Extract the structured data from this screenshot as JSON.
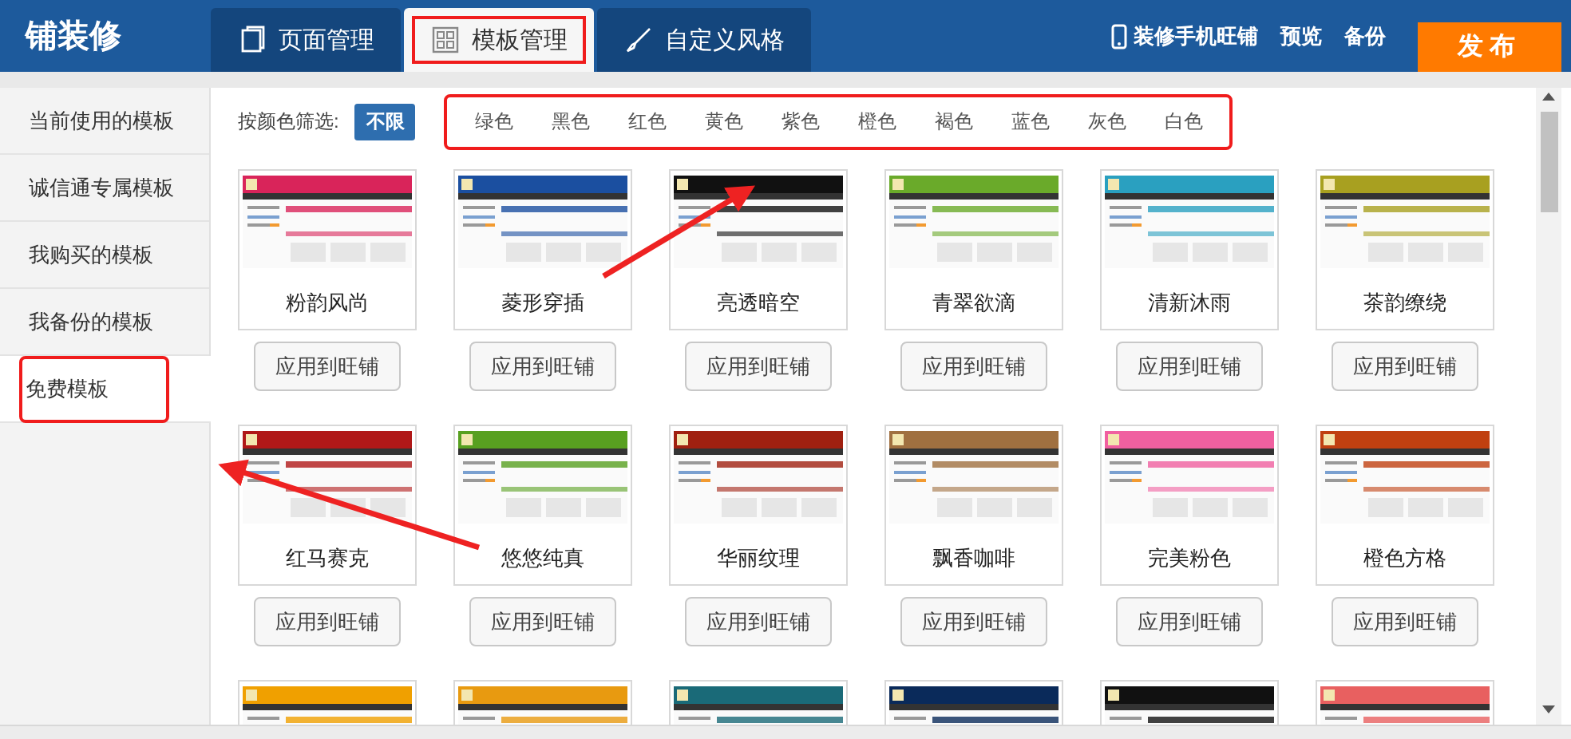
{
  "header": {
    "title": "铺装修",
    "tabs": [
      {
        "label": "页面管理",
        "selected": false,
        "highlighted": false
      },
      {
        "label": "模板管理",
        "selected": true,
        "highlighted": true
      },
      {
        "label": "自定义风格",
        "selected": false,
        "highlighted": false
      }
    ],
    "links": [
      {
        "label": "装修手机旺铺",
        "kind": "phone"
      },
      {
        "label": "预览",
        "kind": "plain"
      },
      {
        "label": "备份",
        "kind": "plain"
      }
    ],
    "publish_button": "发布"
  },
  "sidebar": {
    "items": [
      {
        "label": "当前使用的模板",
        "selected": false,
        "highlighted": false
      },
      {
        "label": "诚信通专属模板",
        "selected": false,
        "highlighted": false
      },
      {
        "label": "我购买的模板",
        "selected": false,
        "highlighted": false
      },
      {
        "label": "我备份的模板",
        "selected": false,
        "highlighted": false
      },
      {
        "label": "免费模板",
        "selected": true,
        "highlighted": true
      }
    ]
  },
  "filter": {
    "label": "按颜色筛选:",
    "highlighted": true,
    "options": [
      {
        "label": "不限",
        "selected": true
      },
      {
        "label": "绿色",
        "selected": false
      },
      {
        "label": "黑色",
        "selected": false
      },
      {
        "label": "红色",
        "selected": false
      },
      {
        "label": "黄色",
        "selected": false
      },
      {
        "label": "紫色",
        "selected": false
      },
      {
        "label": "橙色",
        "selected": false
      },
      {
        "label": "褐色",
        "selected": false
      },
      {
        "label": "蓝色",
        "selected": false
      },
      {
        "label": "灰色",
        "selected": false
      },
      {
        "label": "白色",
        "selected": false
      }
    ]
  },
  "templates": [
    {
      "name": "粉韵风尚",
      "color": "#d9245a",
      "button": "应用到旺铺"
    },
    {
      "name": "菱形穿插",
      "color": "#1b4fa0",
      "button": "应用到旺铺"
    },
    {
      "name": "亮透暗空",
      "color": "#111111",
      "button": "应用到旺铺"
    },
    {
      "name": "青翠欲滴",
      "color": "#6aaa2a",
      "button": "应用到旺铺"
    },
    {
      "name": "清新沐雨",
      "color": "#2aa0c0",
      "button": "应用到旺铺"
    },
    {
      "name": "茶韵缭绕",
      "color": "#a8a020",
      "button": "应用到旺铺"
    },
    {
      "name": "红马赛克",
      "color": "#b01818",
      "button": "应用到旺铺"
    },
    {
      "name": "悠悠纯真",
      "color": "#58a020",
      "button": "应用到旺铺"
    },
    {
      "name": "华丽纹理",
      "color": "#a02010",
      "button": "应用到旺铺"
    },
    {
      "name": "飘香咖啡",
      "color": "#a07040",
      "button": "应用到旺铺"
    },
    {
      "name": "完美粉色",
      "color": "#f060a0",
      "button": "应用到旺铺"
    },
    {
      "name": "橙色方格",
      "color": "#c04010",
      "button": "应用到旺铺"
    },
    {
      "color": "#f0a000"
    },
    {
      "color": "#e89a10"
    },
    {
      "color": "#1a6a78"
    },
    {
      "color": "#0a2a5a"
    },
    {
      "color": "#111111"
    },
    {
      "color": "#e86060"
    }
  ],
  "annotation_arrows": [
    {
      "kind": "arrow"
    },
    {
      "kind": "arrow"
    }
  ]
}
